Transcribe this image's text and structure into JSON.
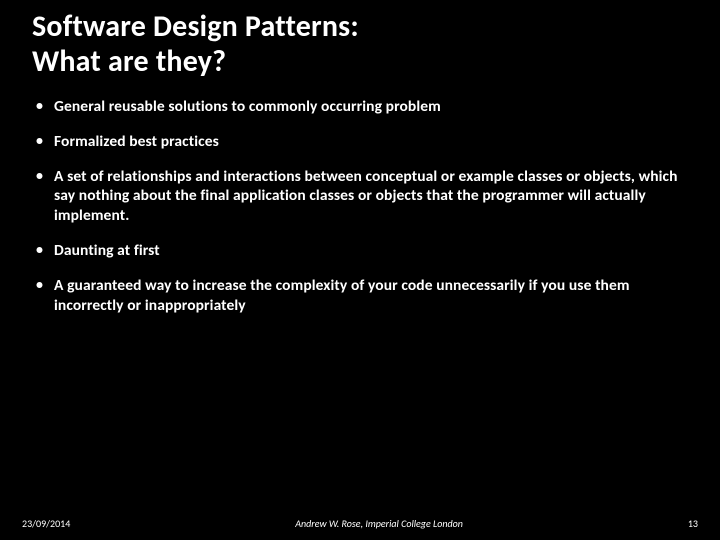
{
  "title_line1": "Software Design Patterns:",
  "title_line2": "What are they?",
  "bullets": [
    "General reusable solutions to commonly occurring problem",
    "Formalized best practices",
    "A set of relationships and interactions between conceptual or example classes or objects, which say nothing about the final application classes or objects that the programmer will actually implement.",
    "Daunting at first",
    "A guaranteed way to increase the complexity of your code unnecessarily if you use them incorrectly or inappropriately"
  ],
  "footer": {
    "date": "23/09/2014",
    "center": "Andrew W. Rose, Imperial College London",
    "page": "13"
  }
}
